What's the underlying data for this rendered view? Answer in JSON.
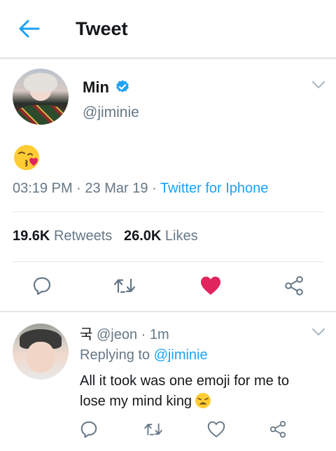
{
  "header": {
    "title": "Tweet",
    "back_icon": "arrow-left-icon",
    "accent": "#1da1f2"
  },
  "tweet": {
    "name": "Min",
    "verified": true,
    "handle": "@jiminie",
    "emoji": "kissing-heart-face",
    "time": "03:19 PM",
    "date": "23 Mar 19",
    "source": "Twitter for Iphone",
    "retweets_count": "19.6K",
    "retweets_label": "Retweets",
    "likes_count": "26.0K",
    "likes_label": "Likes",
    "liked": true,
    "like_color": "#e0245e"
  },
  "reply": {
    "name": "국",
    "handle": "@jeon",
    "time": "1m",
    "replying_prefix": "Replying to",
    "replying_to": "@jiminie",
    "text": "All it took was one emoji for me to lose my mind king",
    "emoji": "weary-face"
  }
}
